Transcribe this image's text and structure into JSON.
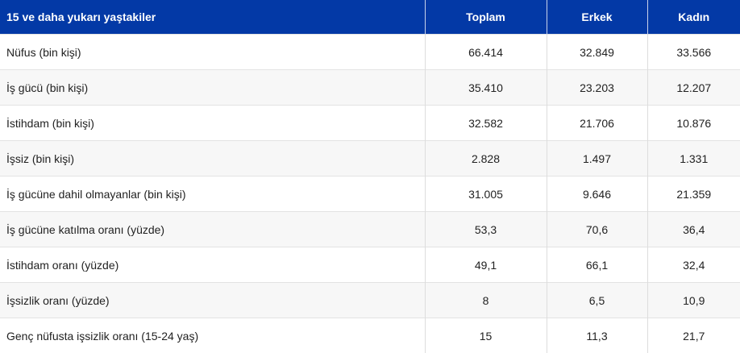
{
  "table": {
    "headers": [
      "15 ve daha yukarı yaştakiler",
      "Toplam",
      "Erkek",
      "Kadın"
    ],
    "rows": [
      [
        "Nüfus (bin kişi)",
        "66.414",
        "32.849",
        "33.566"
      ],
      [
        "İş gücü (bin kişi)",
        "35.410",
        "23.203",
        "12.207"
      ],
      [
        "İstihdam (bin kişi)",
        "32.582",
        "21.706",
        "10.876"
      ],
      [
        "İşsiz (bin kişi)",
        "2.828",
        "1.497",
        "1.331"
      ],
      [
        "İş gücüne dahil olmayanlar (bin kişi)",
        "31.005",
        "9.646",
        "21.359"
      ],
      [
        "İş gücüne katılma oranı (yüzde)",
        "53,3",
        "70,6",
        "36,4"
      ],
      [
        "İstihdam oranı (yüzde)",
        "49,1",
        "66,1",
        "32,4"
      ],
      [
        "İşsizlik oranı (yüzde)",
        "8",
        "6,5",
        "10,9"
      ],
      [
        "Genç nüfusta işsizlik oranı (15-24 yaş)",
        "15",
        "11,3",
        "21,7"
      ]
    ]
  },
  "colors": {
    "header_bg": "#0339a6",
    "header_text": "#ffffff",
    "row_alt_bg": "#f7f7f7"
  }
}
